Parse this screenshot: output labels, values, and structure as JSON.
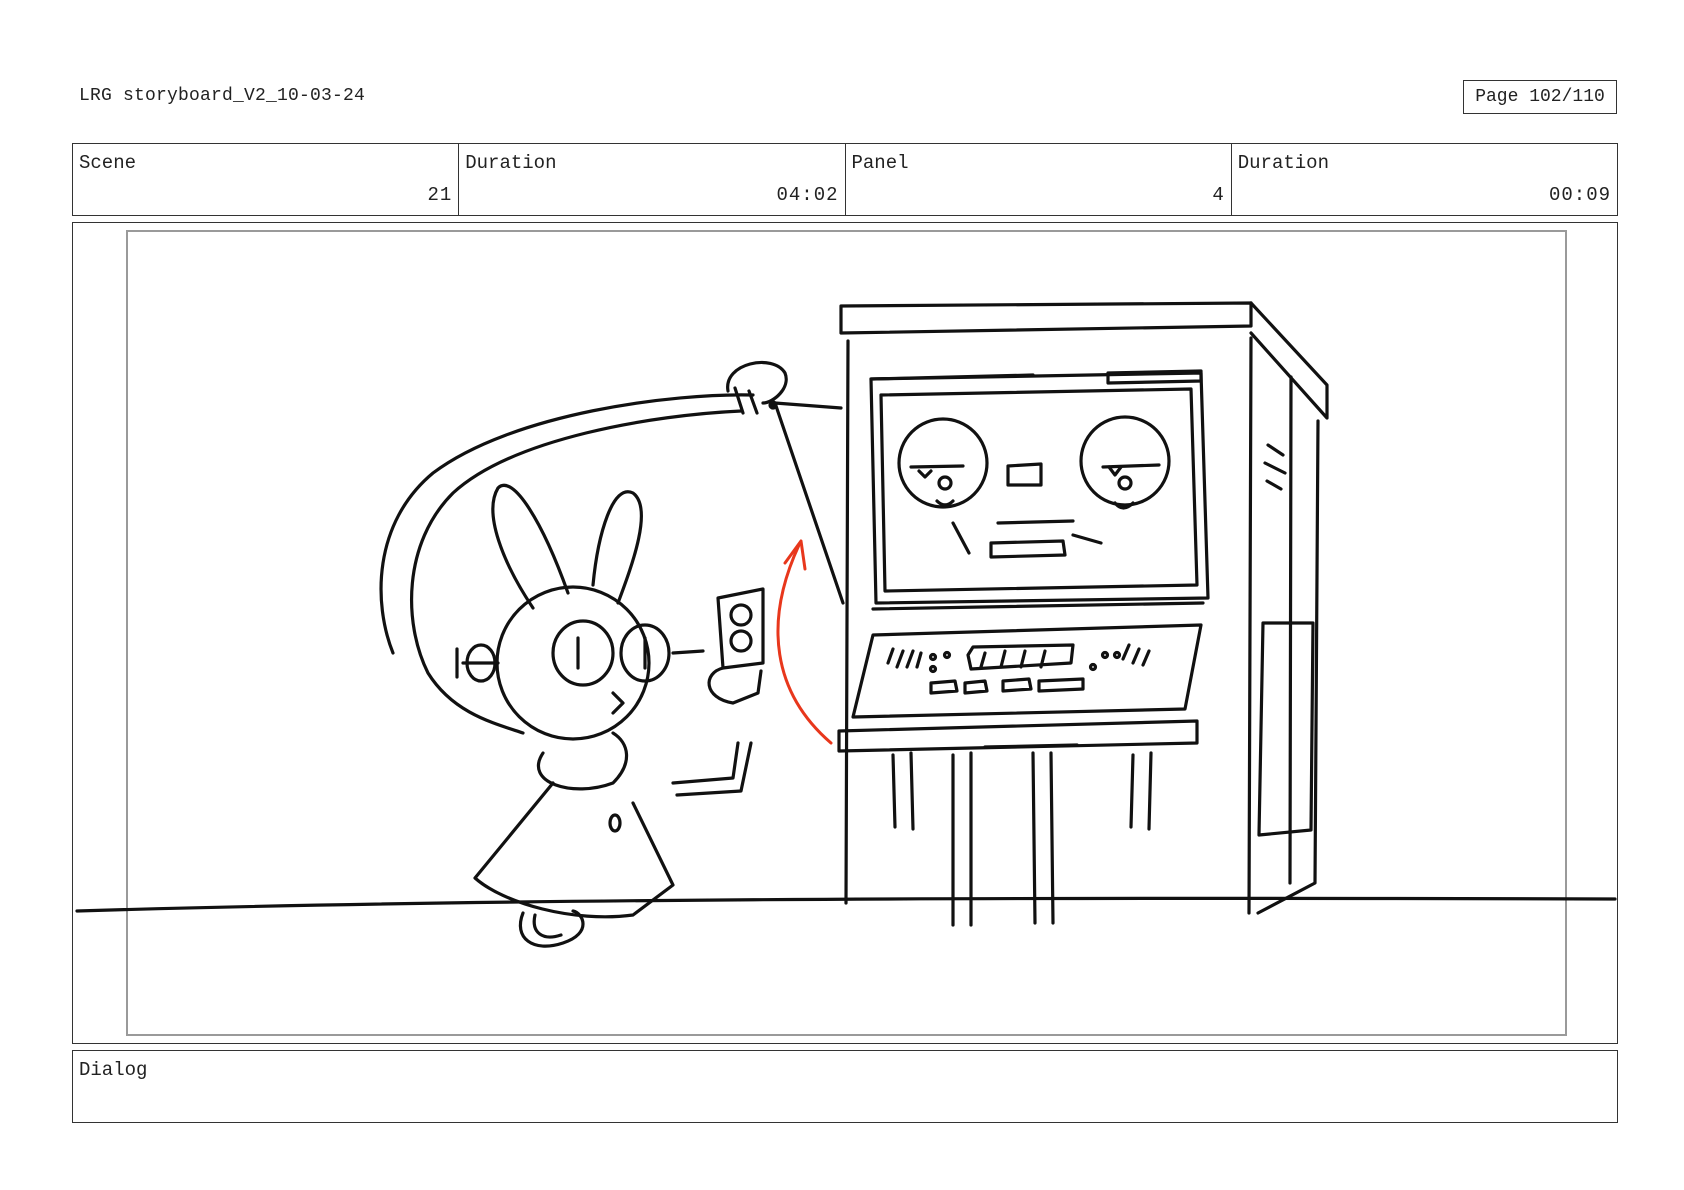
{
  "header": {
    "doc_title": "LRG storyboard_V2_10-03-24",
    "page_label": "Page 102/110"
  },
  "info": [
    {
      "label": "Scene",
      "value": "21"
    },
    {
      "label": "Duration",
      "value": "04:02"
    },
    {
      "label": "Panel",
      "value": "4"
    },
    {
      "label": "Duration",
      "value": "00:09"
    }
  ],
  "panel": {
    "arrow_color": "#e8371c",
    "line_color": "#111111"
  },
  "dialog": {
    "label": "Dialog",
    "text": ""
  }
}
